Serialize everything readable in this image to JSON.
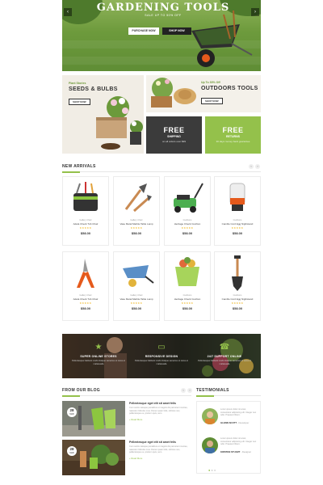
{
  "hero": {
    "title": "GARDENING TOOLS",
    "subtitle": "SALE UP TO 50% OFF",
    "primary_button": "PURCHASE NOW",
    "secondary_button": "SHOP NOW",
    "prev_arrow": "‹",
    "next_arrow": "›"
  },
  "promos": {
    "seeds": {
      "eyebrow": "Plant Stories",
      "title": "SEEDS & BULBS",
      "button": "SHOP NOW"
    },
    "outdoor": {
      "eyebrow": "Up To 30% Off",
      "title": "OUTDOORS TOOLS",
      "button": "SHOP NOW"
    },
    "free_shipping": {
      "big": "FREE",
      "label": "SHIPPING",
      "note": "on all orders over $99"
    },
    "free_returns": {
      "big": "FREE",
      "label": "RETURNS",
      "note": "30 days money back guarantee"
    }
  },
  "new_arrivals": {
    "heading": "NEW ARRIVALS",
    "prev": "‹",
    "next": "›",
    "products": [
      {
        "category": "Gallery Chair",
        "name": "Adela Check Tub Chair",
        "stars": "★★★★★",
        "price": "$58.00",
        "icon": "tool-bag-icon"
      },
      {
        "category": "Gallery Chair",
        "name": "Vase Metal Marble Table Lamp",
        "stars": "★★★★★",
        "price": "$58.00",
        "icon": "hand-tools-icon"
      },
      {
        "category": "Cushions",
        "name": "Heritage Check Cushion",
        "stars": "★★★★★",
        "price": "$58.00",
        "icon": "lawn-mower-icon"
      },
      {
        "category": "Cushions",
        "name": "Camille Cord Egg Nightstand",
        "stars": "★★★★★",
        "price": "$58.00",
        "icon": "garden-gloves-icon"
      },
      {
        "category": "Gallery Chair",
        "name": "Adela Check Tub Chair",
        "stars": "★★★★★",
        "price": "$58.00",
        "icon": "pruning-shears-icon"
      },
      {
        "category": "Gallery Chair",
        "name": "Vase Metal Marble Table Lamp",
        "stars": "★★★★★",
        "price": "$58.00",
        "icon": "wheelbarrow-icon"
      },
      {
        "category": "Cushions",
        "name": "Heritage Check Cushion",
        "stars": "★★★★★",
        "price": "$58.00",
        "icon": "planter-bucket-icon"
      },
      {
        "category": "Cushions",
        "name": "Camille Cord Egg Nightstand",
        "stars": "★★★★★",
        "price": "$58.00",
        "icon": "shovel-icon"
      }
    ]
  },
  "features": [
    {
      "title": "SUPER ONLINE STORES",
      "desc": "Pellentesque habitant morbi tristique senectus et netus et malesuada",
      "icon": "star-icon"
    },
    {
      "title": "RESPONSIVE DESIGN",
      "desc": "Pellentesque habitant morbi tristique senectus et netus et malesuada",
      "icon": "monitor-icon"
    },
    {
      "title": "24/7 SUPPORT ONLINE",
      "desc": "Pellentesque habitant morbi tristique senectus et netus et malesuada",
      "icon": "support-icon"
    }
  ],
  "blog": {
    "heading": "FROM OUR BLOG",
    "prev": "‹",
    "next": "›",
    "posts": [
      {
        "day": "28",
        "month": "MAR",
        "title": "Pellentesque eget elit sit amet felis",
        "excerpt": "Cum sociis natoque penatibus et magnis dis parturient montes, nascetur ridiculus mus. Donec quam felis, ultricies nec, pellentesque eu, pretium quis, sem.",
        "more": "+ Read More"
      },
      {
        "day": "28",
        "month": "MAR",
        "title": "Pellentesque eget elit sit amet felis",
        "excerpt": "Cum sociis natoque penatibus et magnis dis parturient montes, nascetur ridiculus mus. Donec quam felis, ultricies nec, pellentesque eu, pretium quis, sem.",
        "more": "+ Read More"
      }
    ]
  },
  "testimonials": {
    "heading": "TESTIMONIALS",
    "items": [
      {
        "quote": "Lorem ipsum dolor sit amet, consectetur adipiscing elit. Integer nec odio. Praesent libero.",
        "name": "GLENN SCOTT",
        "role": "- Developer"
      },
      {
        "quote": "Lorem ipsum dolor sit amet, consectetur adipiscing elit. Integer nec odio. Praesent libero.",
        "name": "KIRSTEN STUART",
        "role": "- Designer"
      }
    ]
  },
  "colors": {
    "accent": "#94c14b",
    "dark": "#3b3b3b",
    "star": "#f0b61d"
  }
}
